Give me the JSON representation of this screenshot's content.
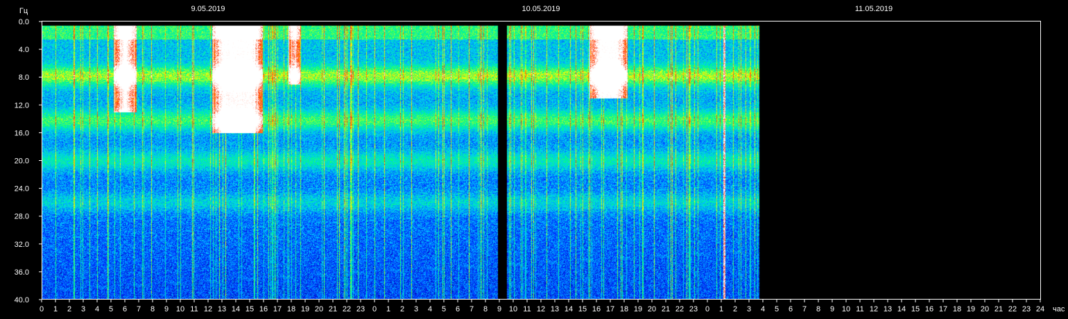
{
  "chart_data": {
    "type": "heatmap",
    "title": "",
    "y_unit_label": "Гц",
    "x_unit_label": "час",
    "ylim": [
      0,
      40
    ],
    "y_ticks": [
      "0.0",
      "4.0",
      "8.0",
      "12.0",
      "16.0",
      "20.0",
      "24.0",
      "28.0",
      "32.0",
      "36.0",
      "40.0"
    ],
    "date_labels": [
      {
        "label": "9.05.2019",
        "hour": 12
      },
      {
        "label": "10.05.2019",
        "hour": 36
      },
      {
        "label": "11.05.2019",
        "hour": 60
      }
    ],
    "x_hour_range": [
      0,
      72
    ],
    "x_tick_labels": [
      "0",
      "1",
      "2",
      "3",
      "4",
      "5",
      "6",
      "7",
      "8",
      "9",
      "10",
      "11",
      "12",
      "13",
      "14",
      "15",
      "16",
      "17",
      "18",
      "19",
      "20",
      "21",
      "22",
      "23",
      "0",
      "1",
      "2",
      "3",
      "4",
      "5",
      "6",
      "7",
      "8",
      "9",
      "10",
      "11",
      "12",
      "13",
      "14",
      "15",
      "16",
      "17",
      "18",
      "19",
      "20",
      "21",
      "22",
      "23",
      "0",
      "1",
      "2",
      "3",
      "4",
      "5",
      "6",
      "7",
      "8",
      "9",
      "10",
      "11",
      "12",
      "13",
      "14",
      "15",
      "16",
      "17",
      "18",
      "19",
      "20",
      "21",
      "22",
      "23",
      "24"
    ],
    "data_end_hour": 51.7,
    "resonance_bands_hz": [
      7.8,
      14.2,
      20.0,
      26.0
    ],
    "bursts": [
      {
        "start_hour": 5.2,
        "end_hour": 6.8,
        "fmax_hz": 13
      },
      {
        "start_hour": 12.3,
        "end_hour": 15.9,
        "fmax_hz": 16
      },
      {
        "start_hour": 17.8,
        "end_hour": 18.6,
        "fmax_hz": 9
      },
      {
        "start_hour": 39.5,
        "end_hour": 42.2,
        "fmax_hz": 11
      }
    ],
    "gaps": [
      {
        "start_hour": 32.9,
        "end_hour": 33.5
      }
    ],
    "spikes_hour": [
      49.2
    ],
    "colorscale": [
      "#000050",
      "#0028ff",
      "#00c8ff",
      "#00ff80",
      "#ffff00",
      "#ff3000",
      "#ffffff"
    ]
  }
}
